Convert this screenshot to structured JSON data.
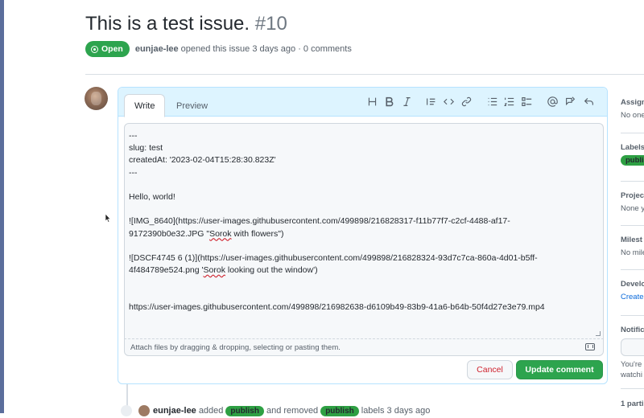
{
  "issue": {
    "title": "This is a test issue.",
    "number": "#10",
    "status": "Open",
    "author": "eunjae-lee",
    "meta": "opened this issue 3 days ago · 0 comments"
  },
  "editor": {
    "tabs": {
      "write": "Write",
      "preview": "Preview"
    },
    "toolbar_icons": [
      "heading-icon",
      "bold-icon",
      "italic-icon",
      "quote-icon",
      "code-icon",
      "link-icon",
      "bulleted-list-icon",
      "numbered-list-icon",
      "task-list-icon",
      "mention-icon",
      "cross-reference-icon",
      "reply-icon"
    ],
    "content": [
      "---",
      "slug: test",
      "createdAt: '2023-02-04T15:28:30.823Z'",
      "---",
      "",
      "Hello, world!",
      "",
      "![IMG_8640](https://user-images.githubusercontent.com/499898/216828317-f11b77f7-c2cf-4488-af17-",
      "9172390b0e32.JPG \"Sorok with flowers\")",
      "",
      "![DSCF4745 6 (1)](https://user-images.githubusercontent.com/499898/216828324-93d7c7ca-860a-4d01-b5ff-",
      "4f484789e524.png 'Sorok looking out the window')",
      "",
      "",
      "https://user-images.githubusercontent.com/499898/216982638-d6109b49-83b9-41a6-b64b-50f4d27e3e79.mp4"
    ],
    "attach_hint": "Attach files by dragging & dropping, selecting or pasting them.",
    "cancel_label": "Cancel",
    "update_label": "Update comment"
  },
  "timeline_event": {
    "author": "eunjae-lee",
    "action_added": "added",
    "label_added": "publish",
    "action_removed": "and removed",
    "label_removed": "publish",
    "suffix": "labels 3 days ago"
  },
  "sidebar": {
    "assignees": {
      "heading": "Assign",
      "value": "No one"
    },
    "labels": {
      "heading": "Labels",
      "value": "publi"
    },
    "projects": {
      "heading": "Projec",
      "value": "None y"
    },
    "milestone": {
      "heading": "Milest",
      "value": "No mile"
    },
    "development": {
      "heading": "Develo",
      "value": "Create"
    },
    "notifications": {
      "heading": "Notific",
      "value1": "You're",
      "value2": "watchi"
    },
    "participants": {
      "heading": "1 parti"
    }
  },
  "colors": {
    "open_green": "#2da44e",
    "label_green": "#2ea043",
    "editor_header": "#ddf4ff",
    "cancel_red": "#cf222e",
    "link_blue": "#0969da"
  }
}
